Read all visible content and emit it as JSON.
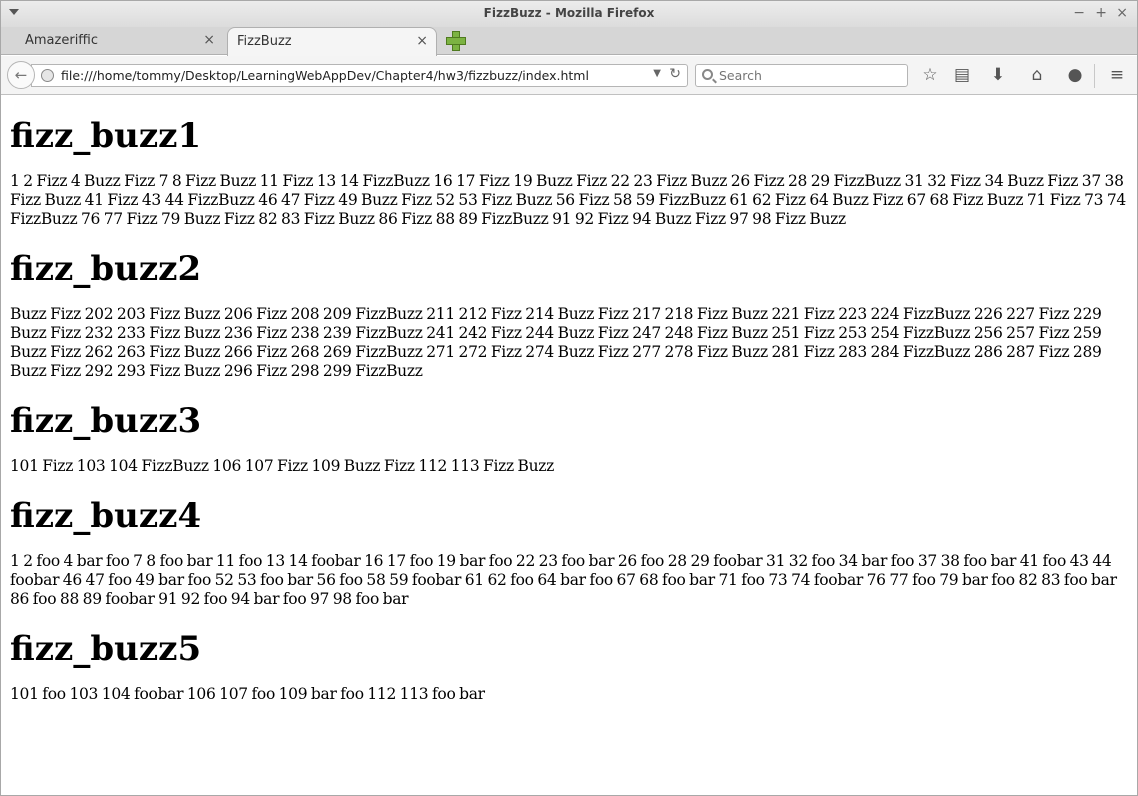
{
  "window": {
    "title": "FizzBuzz - Mozilla Firefox"
  },
  "tabs": [
    {
      "label": "Amazeriffic"
    },
    {
      "label": "FizzBuzz"
    }
  ],
  "navbar": {
    "url": "file:///home/tommy/Desktop/LearningWebAppDev/Chapter4/hw3/fizzbuzz/index.html",
    "search_placeholder": "Search"
  },
  "sections": [
    {
      "heading": "fizz_buzz1",
      "text": "1 2 Fizz 4 Buzz Fizz 7 8 Fizz Buzz 11 Fizz 13 14 FizzBuzz 16 17 Fizz 19 Buzz Fizz 22 23 Fizz Buzz 26 Fizz 28 29 FizzBuzz 31 32 Fizz 34 Buzz Fizz 37 38 Fizz Buzz 41 Fizz 43 44 FizzBuzz 46 47 Fizz 49 Buzz Fizz 52 53 Fizz Buzz 56 Fizz 58 59 FizzBuzz 61 62 Fizz 64 Buzz Fizz 67 68 Fizz Buzz 71 Fizz 73 74 FizzBuzz 76 77 Fizz 79 Buzz Fizz 82 83 Fizz Buzz 86 Fizz 88 89 FizzBuzz 91 92 Fizz 94 Buzz Fizz 97 98 Fizz Buzz"
    },
    {
      "heading": "fizz_buzz2",
      "text": "Buzz Fizz 202 203 Fizz Buzz 206 Fizz 208 209 FizzBuzz 211 212 Fizz 214 Buzz Fizz 217 218 Fizz Buzz 221 Fizz 223 224 FizzBuzz 226 227 Fizz 229 Buzz Fizz 232 233 Fizz Buzz 236 Fizz 238 239 FizzBuzz 241 242 Fizz 244 Buzz Fizz 247 248 Fizz Buzz 251 Fizz 253 254 FizzBuzz 256 257 Fizz 259 Buzz Fizz 262 263 Fizz Buzz 266 Fizz 268 269 FizzBuzz 271 272 Fizz 274 Buzz Fizz 277 278 Fizz Buzz 281 Fizz 283 284 FizzBuzz 286 287 Fizz 289 Buzz Fizz 292 293 Fizz Buzz 296 Fizz 298 299 FizzBuzz"
    },
    {
      "heading": "fizz_buzz3",
      "text": "101 Fizz 103 104 FizzBuzz 106 107 Fizz 109 Buzz Fizz 112 113 Fizz Buzz"
    },
    {
      "heading": "fizz_buzz4",
      "text": "1 2 foo 4 bar foo 7 8 foo bar 11 foo 13 14 foobar 16 17 foo 19 bar foo 22 23 foo bar 26 foo 28 29 foobar 31 32 foo 34 bar foo 37 38 foo bar 41 foo 43 44 foobar 46 47 foo 49 bar foo 52 53 foo bar 56 foo 58 59 foobar 61 62 foo 64 bar foo 67 68 foo bar 71 foo 73 74 foobar 76 77 foo 79 bar foo 82 83 foo bar 86 foo 88 89 foobar 91 92 foo 94 bar foo 97 98 foo bar"
    },
    {
      "heading": "fizz_buzz5",
      "text": "101 foo 103 104 foobar 106 107 foo 109 bar foo 112 113 foo bar"
    }
  ]
}
